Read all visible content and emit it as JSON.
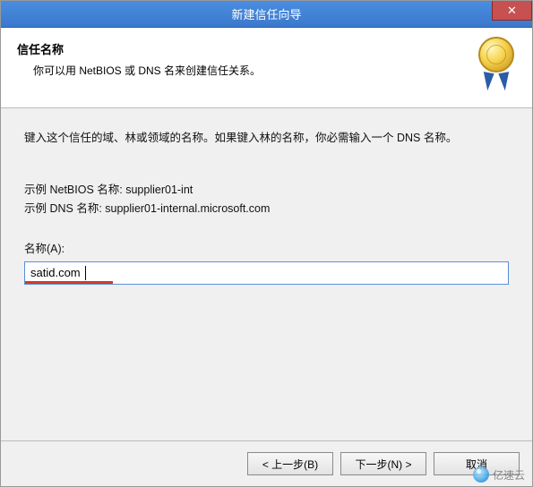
{
  "titlebar": {
    "title": "新建信任向导"
  },
  "header": {
    "title": "信任名称",
    "subtitle": "你可以用 NetBIOS 或 DNS 名来创建信任关系。"
  },
  "body": {
    "instruction": "键入这个信任的域、林或领域的名称。如果键入林的名称，你必需输入一个 DNS 名称。",
    "example_netbios": "示例 NetBIOS 名称: supplier01-int",
    "example_dns": "示例 DNS 名称: supplier01-internal.microsoft.com",
    "field_label": "名称(A):",
    "field_value": "satid.com"
  },
  "footer": {
    "back": "< 上一步(B)",
    "next": "下一步(N) >",
    "cancel": "取消"
  },
  "watermark": {
    "text": "亿速云"
  }
}
